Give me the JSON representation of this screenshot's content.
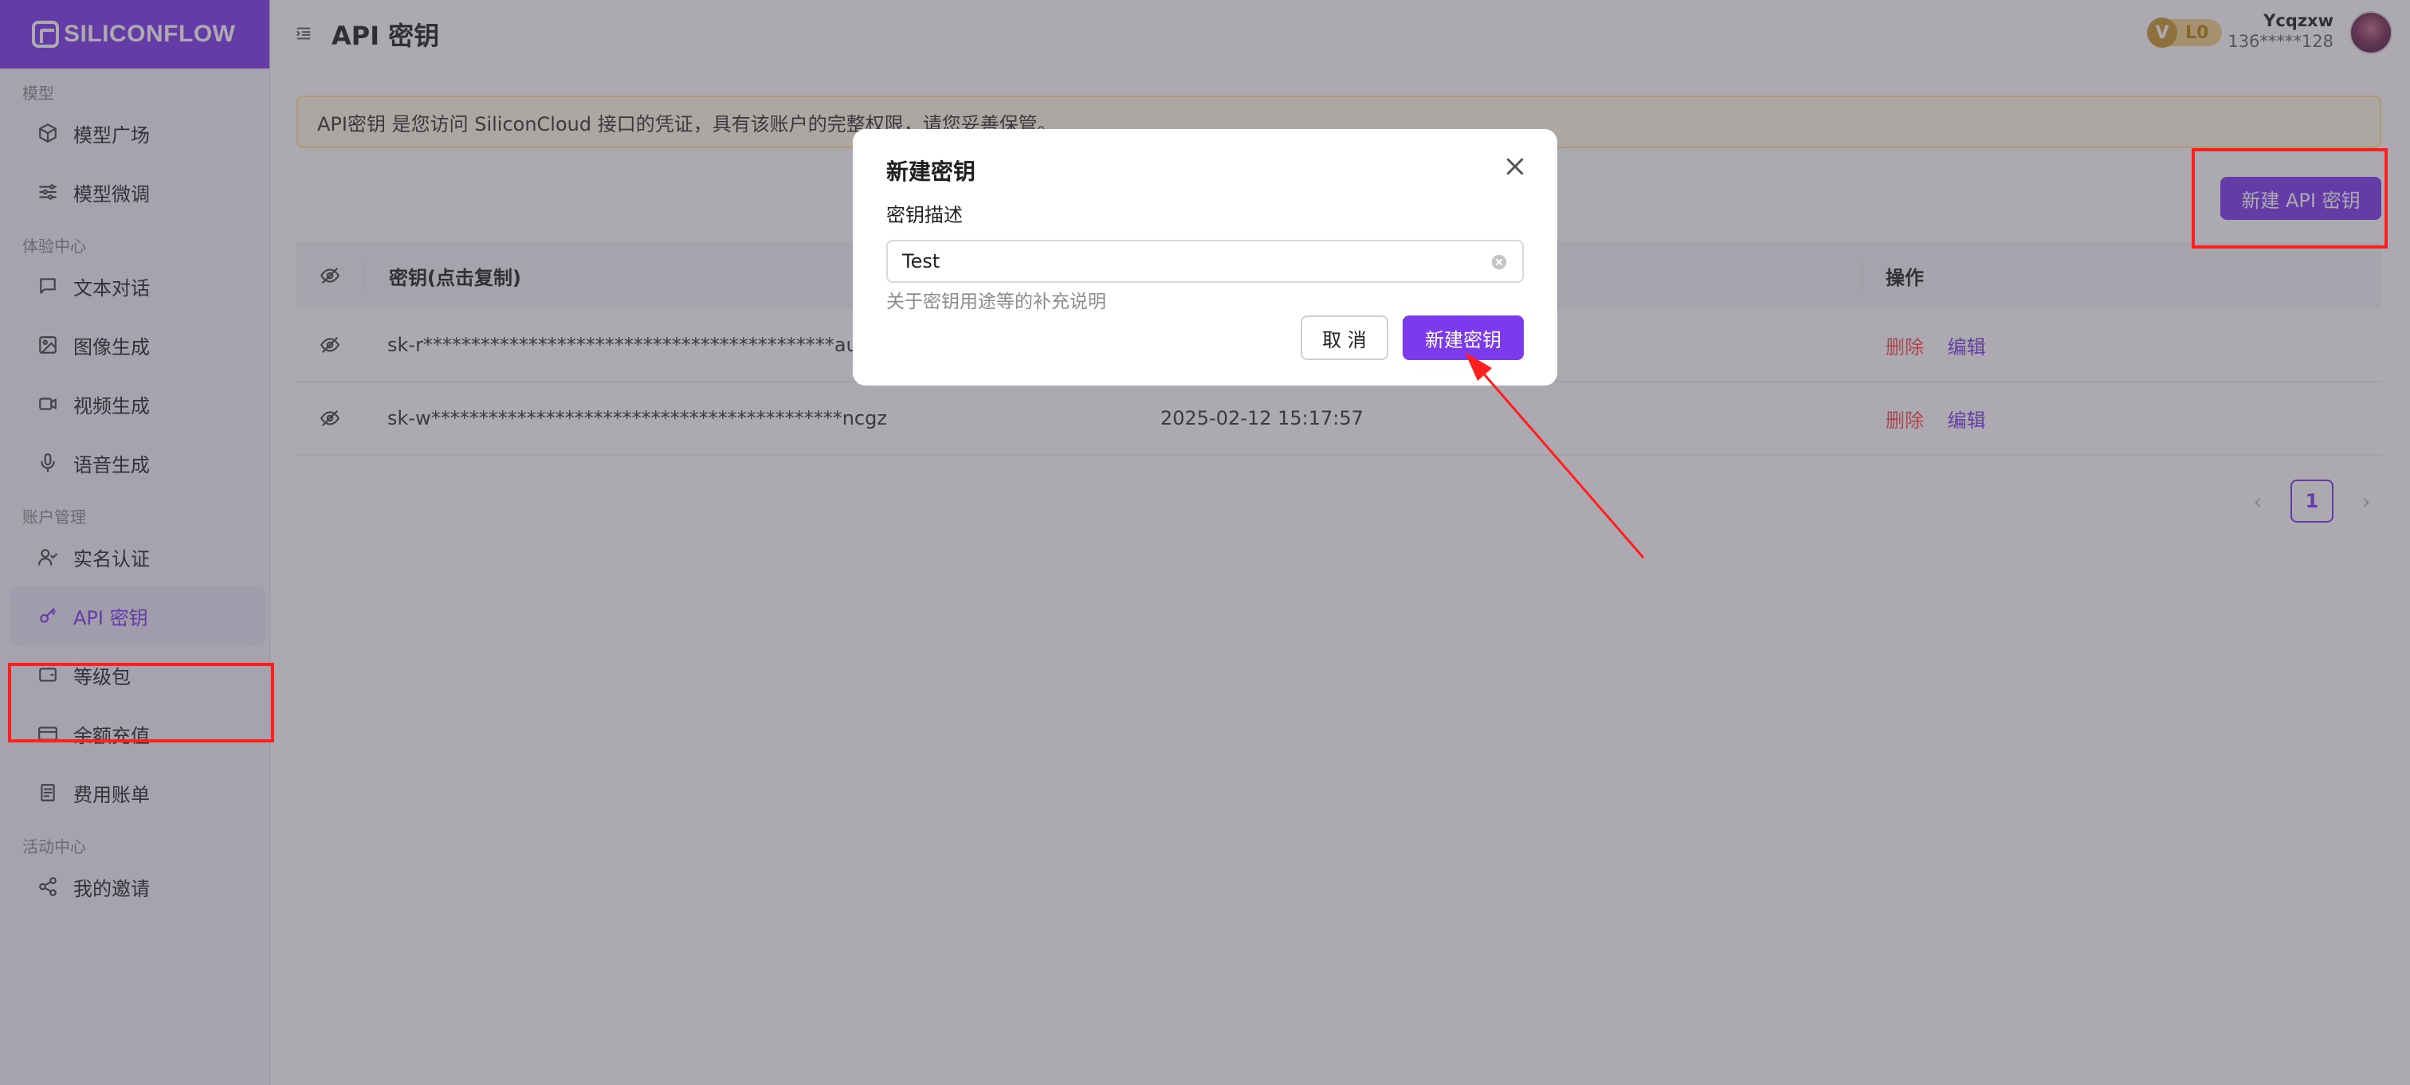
{
  "brand": {
    "name": "SILICONFLOW"
  },
  "sidebar": {
    "sections": [
      {
        "label": "模型",
        "items": [
          {
            "label": "模型广场",
            "icon": "cube-icon"
          },
          {
            "label": "模型微调",
            "icon": "sliders-icon"
          }
        ]
      },
      {
        "label": "体验中心",
        "items": [
          {
            "label": "文本对话",
            "icon": "chat-icon"
          },
          {
            "label": "图像生成",
            "icon": "image-icon"
          },
          {
            "label": "视频生成",
            "icon": "video-icon"
          },
          {
            "label": "语音生成",
            "icon": "mic-icon"
          }
        ]
      },
      {
        "label": "账户管理",
        "items": [
          {
            "label": "实名认证",
            "icon": "user-check-icon"
          },
          {
            "label": "API 密钥",
            "icon": "key-icon",
            "active": true
          },
          {
            "label": "等级包",
            "icon": "wallet-icon"
          },
          {
            "label": "余额充值",
            "icon": "card-icon"
          },
          {
            "label": "费用账单",
            "icon": "bill-icon"
          }
        ]
      },
      {
        "label": "活动中心",
        "items": [
          {
            "label": "我的邀请",
            "icon": "share-icon"
          }
        ]
      }
    ]
  },
  "header": {
    "title": "API 密钥",
    "level_icon": "V",
    "level": "L0",
    "user_name": "Ycqzxw",
    "user_phone": "136*****128"
  },
  "notice": "API密钥 是您访问 SiliconCloud 接口的凭证，具有该账户的完整权限，请您妥善保管。",
  "new_key_button": "新建 API 密钥",
  "table": {
    "columns": [
      "密钥(点击复制)",
      "",
      "操作"
    ],
    "rows": [
      {
        "key": "sk-r*******************************************aumr",
        "created": "",
        "delete": "删除",
        "edit": "编辑"
      },
      {
        "key": "sk-w*******************************************ncgz",
        "created": "2025-02-12 15:17:57",
        "delete": "删除",
        "edit": "编辑"
      }
    ]
  },
  "pagination": {
    "current": "1",
    "prev": "‹",
    "next": "›"
  },
  "modal": {
    "title": "新建密钥",
    "field_label": "密钥描述",
    "field_value": "Test",
    "field_help": "关于密钥用途等的补充说明",
    "cancel": "取 消",
    "submit": "新建密钥"
  },
  "colors": {
    "accent": "#7c3aed",
    "danger": "#ff4d4f",
    "annotation": "#ff1f1f"
  }
}
